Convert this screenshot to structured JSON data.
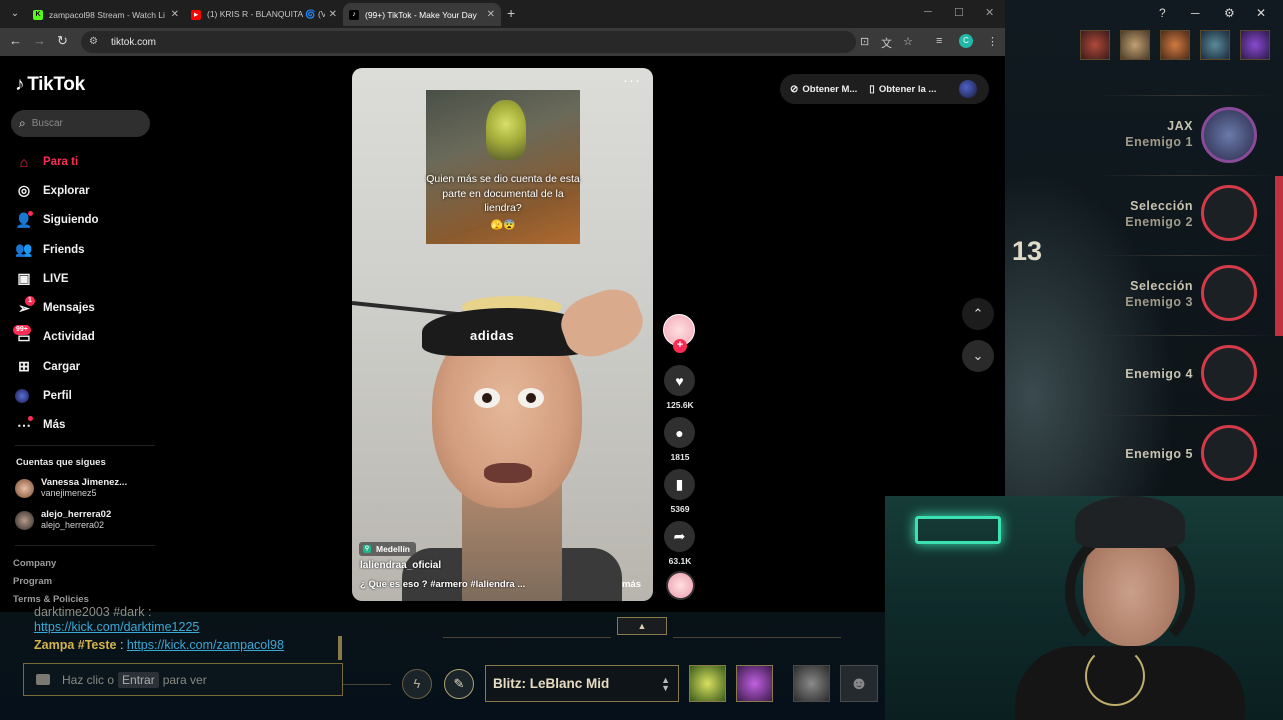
{
  "browser": {
    "tabs": [
      {
        "title": "zampacol98 Stream - Watch Li",
        "fav": "K",
        "fav_color": "#53fc18"
      },
      {
        "title": "(1) KRIS R - BLANQUITA 🌀 (V",
        "fav": "▶",
        "fav_color": "#ff0000"
      },
      {
        "title": "(99+) TikTok - Make Your Day",
        "fav": "♪",
        "fav_color": "#ffffff"
      }
    ],
    "url": "tiktok.com",
    "profile_initial": "C"
  },
  "tiktok": {
    "logo": "TikTok",
    "search_placeholder": "Buscar",
    "nav": [
      {
        "label": "Para ti",
        "icon": "home-icon"
      },
      {
        "label": "Explorar",
        "icon": "compass-icon"
      },
      {
        "label": "Siguiendo",
        "icon": "following-icon"
      },
      {
        "label": "Friends",
        "icon": "friends-icon"
      },
      {
        "label": "LIVE",
        "icon": "live-icon"
      },
      {
        "label": "Mensajes",
        "icon": "messages-icon",
        "badge": "1"
      },
      {
        "label": "Actividad",
        "icon": "activity-icon",
        "badge": "99+"
      },
      {
        "label": "Cargar",
        "icon": "upload-icon"
      },
      {
        "label": "Perfil",
        "icon": "profile-icon"
      },
      {
        "label": "Más",
        "icon": "more-icon"
      }
    ],
    "following_title": "Cuentas que sigues",
    "following": [
      {
        "name": "Vanessa Jimenez...",
        "handle": "vanejimenez5"
      },
      {
        "name": "alejo_herrera02",
        "handle": "alejo_herrera02"
      }
    ],
    "footer": [
      "Company",
      "Program",
      "Terms & Policies"
    ],
    "top_buttons": [
      "Obtener M...",
      "Obtener la ..."
    ],
    "video": {
      "clip_caption": "Quien más se dio cuenta de esta parte en documental de la liendra?",
      "clip_emoji": "🫣😨",
      "shirt_brand": "adidas",
      "location": "Medellín",
      "username": "laliendraa_oficial",
      "description": "¿ Que es eso ? #armero #laliendra ...",
      "more": "más"
    },
    "actions": {
      "likes": "125.6K",
      "comments": "1815",
      "saves": "5369",
      "shares": "63.1K"
    }
  },
  "lol": {
    "enemies": [
      {
        "line1": "JAX",
        "line2": "Enemigo 1"
      },
      {
        "line1": "Selección",
        "line2": "Enemigo 2"
      },
      {
        "line1": "Selección",
        "line2": "Enemigo 3"
      },
      {
        "line1": "",
        "line2": "Enemigo 4"
      },
      {
        "line1": "",
        "line2": "Enemigo 5"
      }
    ],
    "timer": "13",
    "chat": {
      "line0": "darktime2003 #dark :",
      "link1": "https://kick.com/darktime1225",
      "sender": "Zampa #Teste",
      "link2": "https://kick.com/zampacol98",
      "input_prefix": "Haz clic o",
      "input_key": "Entrar",
      "input_suffix": "para ver"
    },
    "skin_select": "Blitz: LeBlanc Mid",
    "colors": {
      "accent_gold": "#8a7a4a",
      "enemy_ring": "#d43a48"
    }
  }
}
